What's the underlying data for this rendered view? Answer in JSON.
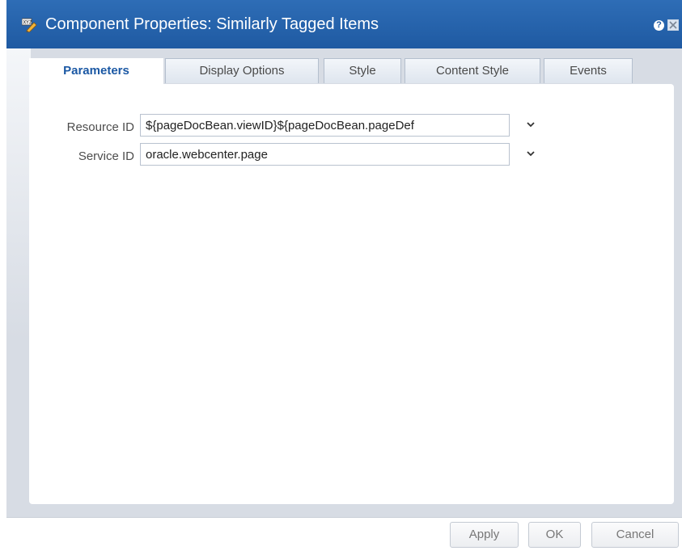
{
  "dialog": {
    "title": "Component Properties: Similarly Tagged Items",
    "help_symbol": "?"
  },
  "tabs": [
    {
      "label": "Parameters",
      "active": true
    },
    {
      "label": "Display Options",
      "active": false
    },
    {
      "label": "Style",
      "active": false
    },
    {
      "label": "Content Style",
      "active": false
    },
    {
      "label": "Events",
      "active": false
    }
  ],
  "params": {
    "resource_id": {
      "label": "Resource ID",
      "value": "${pageDocBean.viewID}${pageDocBean.pageDef"
    },
    "service_id": {
      "label": "Service ID",
      "value": "oracle.webcenter.page"
    }
  },
  "buttons": {
    "apply": "Apply",
    "ok": "OK",
    "cancel": "Cancel"
  },
  "colors": {
    "titlebar": "#1f5aa2",
    "active_tab_text": "#1b58a4",
    "panel": "#d7dce4"
  }
}
